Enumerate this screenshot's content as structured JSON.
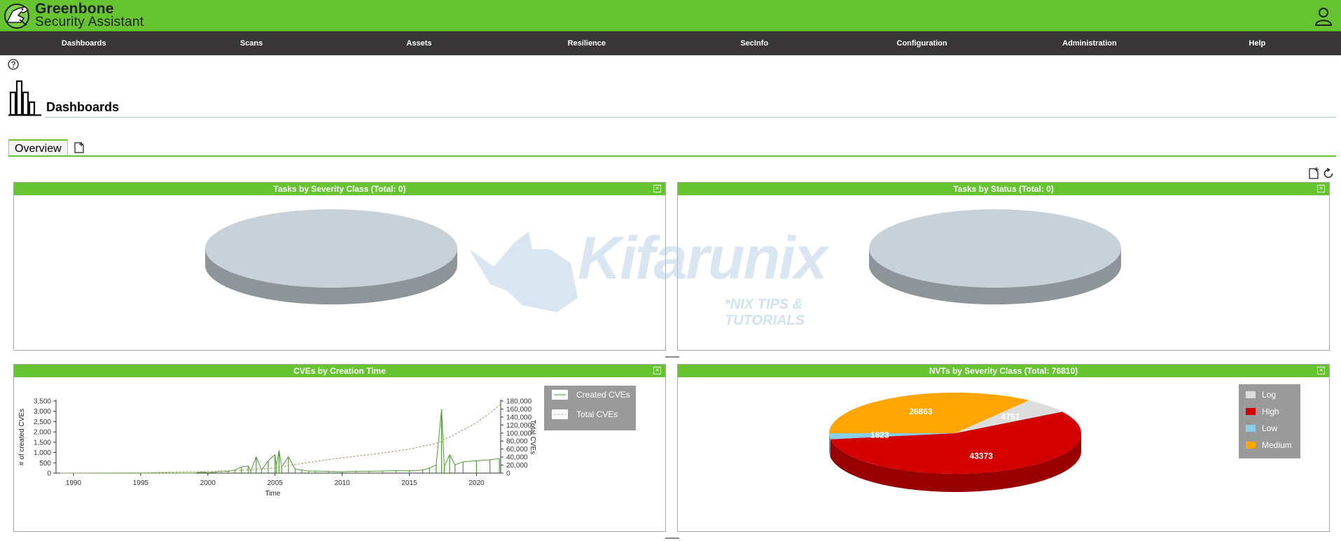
{
  "brand": {
    "line1": "Greenbone",
    "line2": "Security Assistant"
  },
  "menu": [
    "Dashboards",
    "Scans",
    "Assets",
    "Resilience",
    "SecInfo",
    "Configuration",
    "Administration",
    "Help"
  ],
  "page": {
    "title": "Dashboards"
  },
  "tabs": [
    {
      "label": "Overview"
    }
  ],
  "watermark": {
    "text": "Kifarunix",
    "sub": "*NIX TIPS & TUTORIALS"
  },
  "panels": {
    "tasks_severity": {
      "title": "Tasks by Severity Class (Total: 0)"
    },
    "tasks_status": {
      "title": "Tasks by Status (Total: 0)"
    },
    "cves_time": {
      "title": "CVEs by Creation Time"
    },
    "nvts_severity": {
      "title": "NVTs by Severity Class (Total: 76810)"
    }
  },
  "icons": {
    "logo": "greenbone-dinosaur-icon",
    "user": "user-icon",
    "help": "help-icon",
    "dashboard": "dashboard-bars-icon",
    "add_tab": "add-tab-icon",
    "new_dashboard": "new-dashboard-icon",
    "reset": "reset-icon",
    "close": "close-icon"
  },
  "colors": {
    "brand_green": "#66c430",
    "menubar": "#393637",
    "pie_empty_top": "#c8d1d8",
    "pie_empty_side": "#8d9599",
    "high": "#d40000",
    "medium": "#ffa500",
    "low": "#87ceeb",
    "log": "#dddddd",
    "cve_line": "#4f9a36"
  },
  "chart_data": [
    {
      "id": "nvts-by-severity",
      "type": "pie",
      "title": "NVTs by Severity Class (Total: 76810)",
      "legend": [
        "Log",
        "High",
        "Low",
        "Medium"
      ],
      "legend_position": "top-right",
      "slices": [
        {
          "label": "Medium",
          "value": 26863,
          "color": "#ffa500"
        },
        {
          "label": "Log",
          "value": 4751,
          "color": "#dddddd"
        },
        {
          "label": "High",
          "value": 43373,
          "color": "#d40000"
        },
        {
          "label": "Low",
          "value": 1823,
          "color": "#87ceeb"
        }
      ]
    },
    {
      "id": "cves-by-creation-time",
      "type": "line",
      "title": "CVEs by Creation Time",
      "xlabel": "Time",
      "ylabel": "# of created CVEs",
      "y2label": "Total CVEs",
      "xlim": [
        1988.7,
        2021.8
      ],
      "ylim": [
        0,
        3500
      ],
      "y2lim": [
        0,
        180000
      ],
      "xticks": [
        1990,
        1995,
        2000,
        2005,
        2010,
        2015,
        2020
      ],
      "yticks": [
        0,
        500,
        1000,
        1500,
        2000,
        2500,
        3000,
        3500
      ],
      "y2ticks": [
        0,
        20000,
        40000,
        60000,
        80000,
        100000,
        120000,
        140000,
        160000,
        180000
      ],
      "legend_position": "top-right",
      "series": [
        {
          "name": "Created CVEs",
          "style": "solid",
          "x": [
            1989,
            1995,
            1999.0,
            1999.5,
            2000.0,
            2000.5,
            2001.0,
            2001.5,
            2002.0,
            2002.5,
            2003.0,
            2003.2,
            2003.6,
            2004.0,
            2004.5,
            2005.0,
            2005.1,
            2005.3,
            2005.5,
            2006.0,
            2006.5,
            2007.0,
            2007.5,
            2008.0,
            2009.0,
            2010.0,
            2011.0,
            2012.0,
            2013.0,
            2014.0,
            2015.0,
            2016.0,
            2016.5,
            2017.0,
            2017.4,
            2017.6,
            2018.0,
            2018.4,
            2019.0,
            2020.0,
            2021.0,
            2021.7
          ],
          "values": [
            0,
            0,
            0,
            50,
            20,
            40,
            100,
            80,
            150,
            300,
            350,
            100,
            800,
            150,
            600,
            900,
            350,
            1100,
            300,
            800,
            200,
            150,
            100,
            100,
            80,
            70,
            90,
            90,
            100,
            120,
            110,
            150,
            250,
            400,
            3100,
            300,
            900,
            400,
            550,
            600,
            650,
            700
          ]
        },
        {
          "name": "Total CVEs",
          "style": "dashed",
          "axis": "right",
          "x": [
            1989,
            1995,
            2000,
            2003,
            2005,
            2007,
            2009,
            2011,
            2013,
            2015,
            2017,
            2018,
            2019,
            2020,
            2021,
            2021.8
          ],
          "values": [
            0,
            1000,
            4000,
            8000,
            13000,
            24000,
            34000,
            42000,
            50000,
            60000,
            74000,
            90000,
            108000,
            126000,
            150000,
            172000
          ]
        }
      ]
    },
    {
      "id": "tasks-by-severity",
      "type": "pie",
      "title": "Tasks by Severity Class (Total: 0)",
      "slices": []
    },
    {
      "id": "tasks-by-status",
      "type": "pie",
      "title": "Tasks by Status (Total: 0)",
      "slices": []
    }
  ]
}
